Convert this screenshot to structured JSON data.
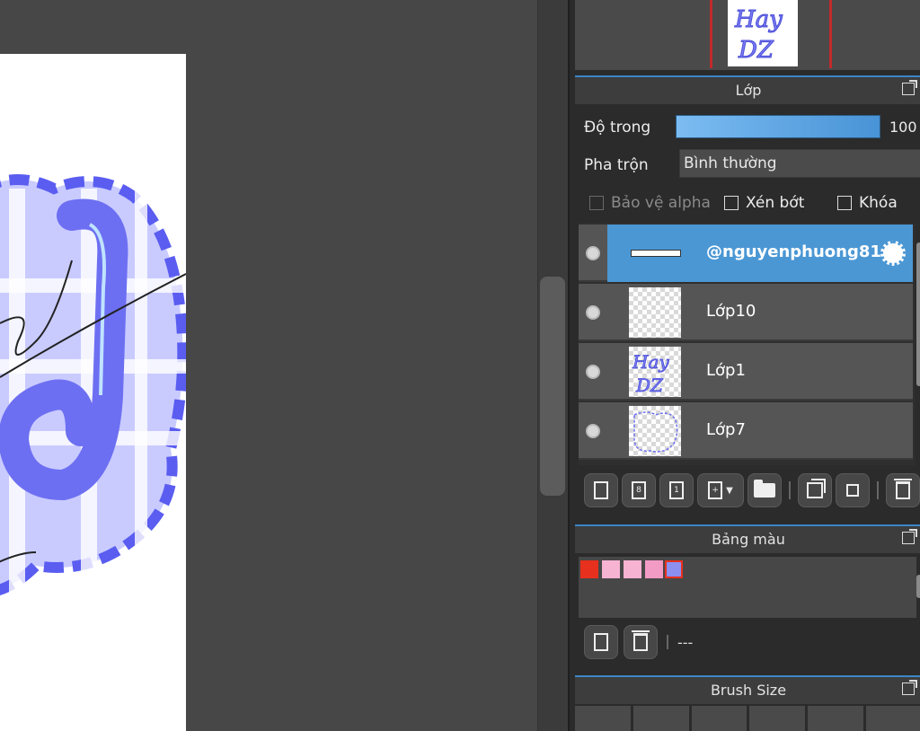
{
  "colors": {
    "accent": "#4b97d4",
    "panel_bg": "#2b2b2b",
    "canvas_bg": "#474747",
    "nav_frame": "#c22a2a"
  },
  "layer_panel": {
    "title": "Lớp",
    "opacity_label": "Độ trong",
    "opacity_value": "100",
    "opacity_fraction": 1.0,
    "blend_label": "Pha trộn",
    "blend_value": "Bình thường",
    "checkboxes": {
      "protect_alpha": "Bảo vệ alpha",
      "clipping": "Xén bớt",
      "lock": "Khóa"
    },
    "layers": [
      {
        "name": "@nguyenphuong81",
        "selected": true
      },
      {
        "name": "Lớp10",
        "selected": false
      },
      {
        "name": "Lớp1",
        "selected": false
      },
      {
        "name": "Lớp7",
        "selected": false
      }
    ],
    "toolbar_icons": [
      "new-layer-icon",
      "new-8bit-layer-icon",
      "new-1bit-layer-icon",
      "add-layer-menu-icon",
      "folder-icon",
      "duplicate-icon",
      "merge-down-icon",
      "delete-icon"
    ]
  },
  "palette_panel": {
    "title": "Bảng màu",
    "swatches": [
      "#e8301e",
      "#f6b3d2",
      "#f6b3d2",
      "#f29bc4",
      "#8c8ef0"
    ],
    "selected_name": "---"
  },
  "brush_panel": {
    "title": "Brush Size"
  }
}
